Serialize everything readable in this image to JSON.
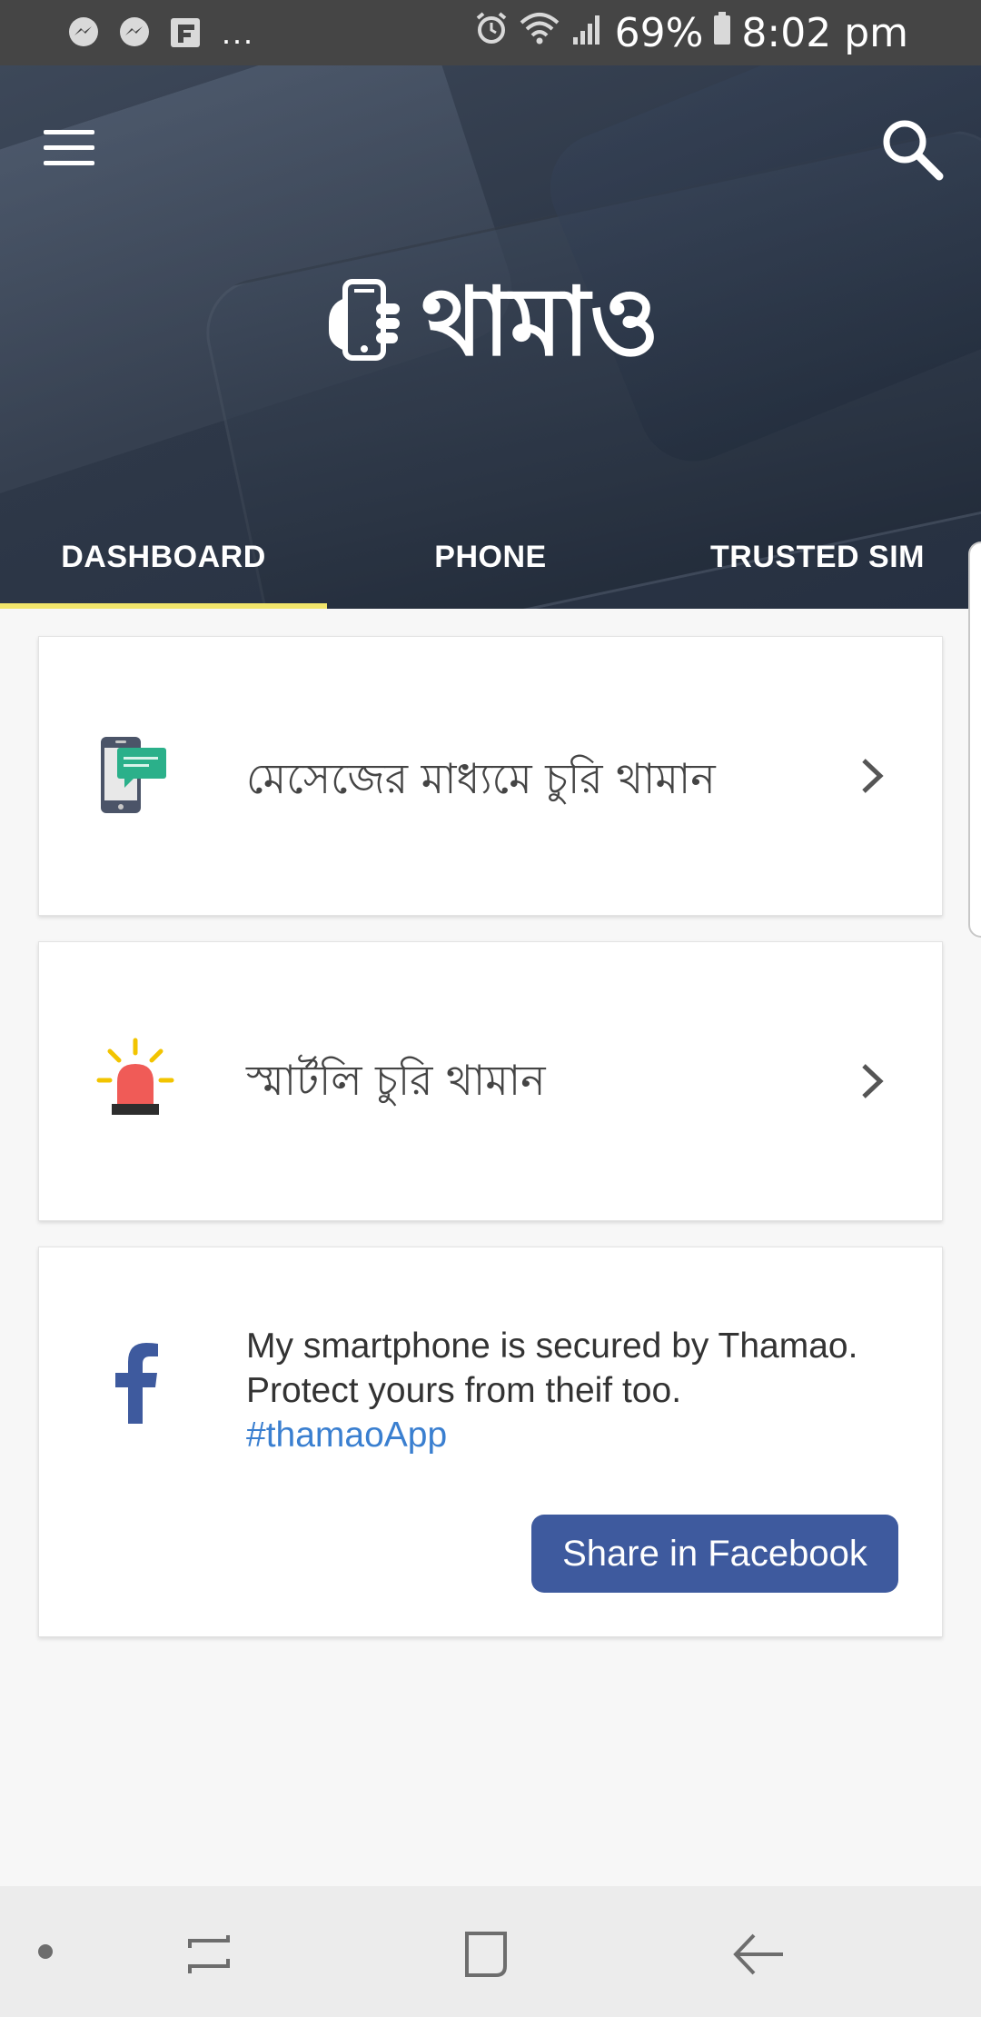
{
  "status_bar": {
    "notification_icons": [
      "messenger-icon",
      "messenger-icon",
      "flipboard-icon"
    ],
    "more": "...",
    "battery": "69%",
    "time": "8:02 pm"
  },
  "header": {
    "app_name": "থামাও",
    "tabs": [
      {
        "label": "DASHBOARD",
        "active": true
      },
      {
        "label": "PHONE",
        "active": false
      },
      {
        "label": "TRUSTED SIM",
        "active": false
      }
    ]
  },
  "cards": [
    {
      "label": "মেসেজের মাধ্যমে চুরি থামান",
      "icon": "phone-message-icon"
    },
    {
      "label": "স্মার্টলি চুরি থামান",
      "icon": "siren-alarm-icon"
    }
  ],
  "share_card": {
    "message": "My smartphone is secured by Thamao. Protect yours from theif too.",
    "hashtag": "#thamaoApp",
    "button_label": "Share in Facebook",
    "icon": "facebook-icon"
  },
  "colors": {
    "tab_indicator": "#f1e56b",
    "facebook_blue": "#3e5a9e",
    "hashtag": "#3a7fd0"
  }
}
